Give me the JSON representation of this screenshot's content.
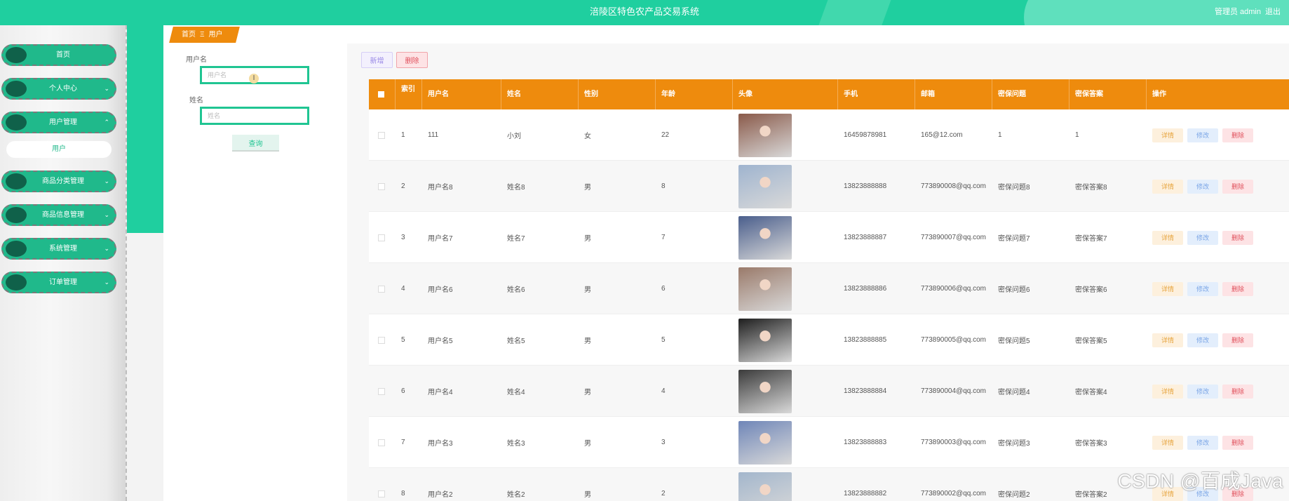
{
  "header": {
    "title": "涪陵区特色农产品交易系统",
    "user_label": "管理员 admin",
    "logout_label": "退出"
  },
  "sidebar": {
    "items": [
      {
        "label": "首页",
        "chevron": ""
      },
      {
        "label": "个人中心",
        "chevron": "⌄"
      },
      {
        "label": "用户管理",
        "chevron": "⌃"
      },
      {
        "label": "商品分类管理",
        "chevron": "⌄"
      },
      {
        "label": "商品信息管理",
        "chevron": "⌄"
      },
      {
        "label": "系统管理",
        "chevron": "⌄"
      },
      {
        "label": "订单管理",
        "chevron": "⌄"
      }
    ],
    "submenu": {
      "label": "用户"
    }
  },
  "breadcrumb": {
    "home": "首页",
    "sep": "Ξ",
    "current": "用户"
  },
  "search": {
    "username_label": "用户名",
    "username_placeholder": "用户名",
    "name_label": "姓名",
    "name_placeholder": "姓名",
    "query_label": "查询"
  },
  "toolbar": {
    "add_label": "新增",
    "delete_label": "删除"
  },
  "table": {
    "headers": [
      "索引",
      "用户名",
      "姓名",
      "性别",
      "年龄",
      "头像",
      "手机",
      "邮箱",
      "密保问题",
      "密保答案",
      "操作"
    ],
    "rows": [
      {
        "index": "1",
        "username": "111",
        "name": "小刘",
        "gender": "女",
        "age": "22",
        "phone": "16459878981",
        "email": "165@12.com",
        "question": "1",
        "answer": "1"
      },
      {
        "index": "2",
        "username": "用户名8",
        "name": "姓名8",
        "gender": "男",
        "age": "8",
        "phone": "13823888888",
        "email": "773890008@qq.com",
        "question": "密保问题8",
        "answer": "密保答案8"
      },
      {
        "index": "3",
        "username": "用户名7",
        "name": "姓名7",
        "gender": "男",
        "age": "7",
        "phone": "13823888887",
        "email": "773890007@qq.com",
        "question": "密保问题7",
        "answer": "密保答案7"
      },
      {
        "index": "4",
        "username": "用户名6",
        "name": "姓名6",
        "gender": "男",
        "age": "6",
        "phone": "13823888886",
        "email": "773890006@qq.com",
        "question": "密保问题6",
        "answer": "密保答案6"
      },
      {
        "index": "5",
        "username": "用户名5",
        "name": "姓名5",
        "gender": "男",
        "age": "5",
        "phone": "13823888885",
        "email": "773890005@qq.com",
        "question": "密保问题5",
        "answer": "密保答案5"
      },
      {
        "index": "6",
        "username": "用户名4",
        "name": "姓名4",
        "gender": "男",
        "age": "4",
        "phone": "13823888884",
        "email": "773890004@qq.com",
        "question": "密保问题4",
        "answer": "密保答案4"
      },
      {
        "index": "7",
        "username": "用户名3",
        "name": "姓名3",
        "gender": "男",
        "age": "3",
        "phone": "13823888883",
        "email": "773890003@qq.com",
        "question": "密保问题3",
        "answer": "密保答案3"
      },
      {
        "index": "8",
        "username": "用户名2",
        "name": "姓名2",
        "gender": "男",
        "age": "2",
        "phone": "13823888882",
        "email": "773890002@qq.com",
        "question": "密保问题2",
        "answer": "密保答案2"
      }
    ],
    "actions": {
      "detail": "详情",
      "edit": "修改",
      "delete": "删除"
    }
  },
  "watermark": "CSDN @百成Java",
  "colors": {
    "primary": "#1fcf9f",
    "header_orange": "#ee8b0d",
    "sidebar_item": "#20b98b"
  },
  "avatar_colors": [
    "#8a5a4a",
    "#9fb4cf",
    "#4a5e8c",
    "#9a7a6a",
    "#1e1e1e",
    "#3b3b3b",
    "#6f86b8",
    "#a3b6cc"
  ]
}
